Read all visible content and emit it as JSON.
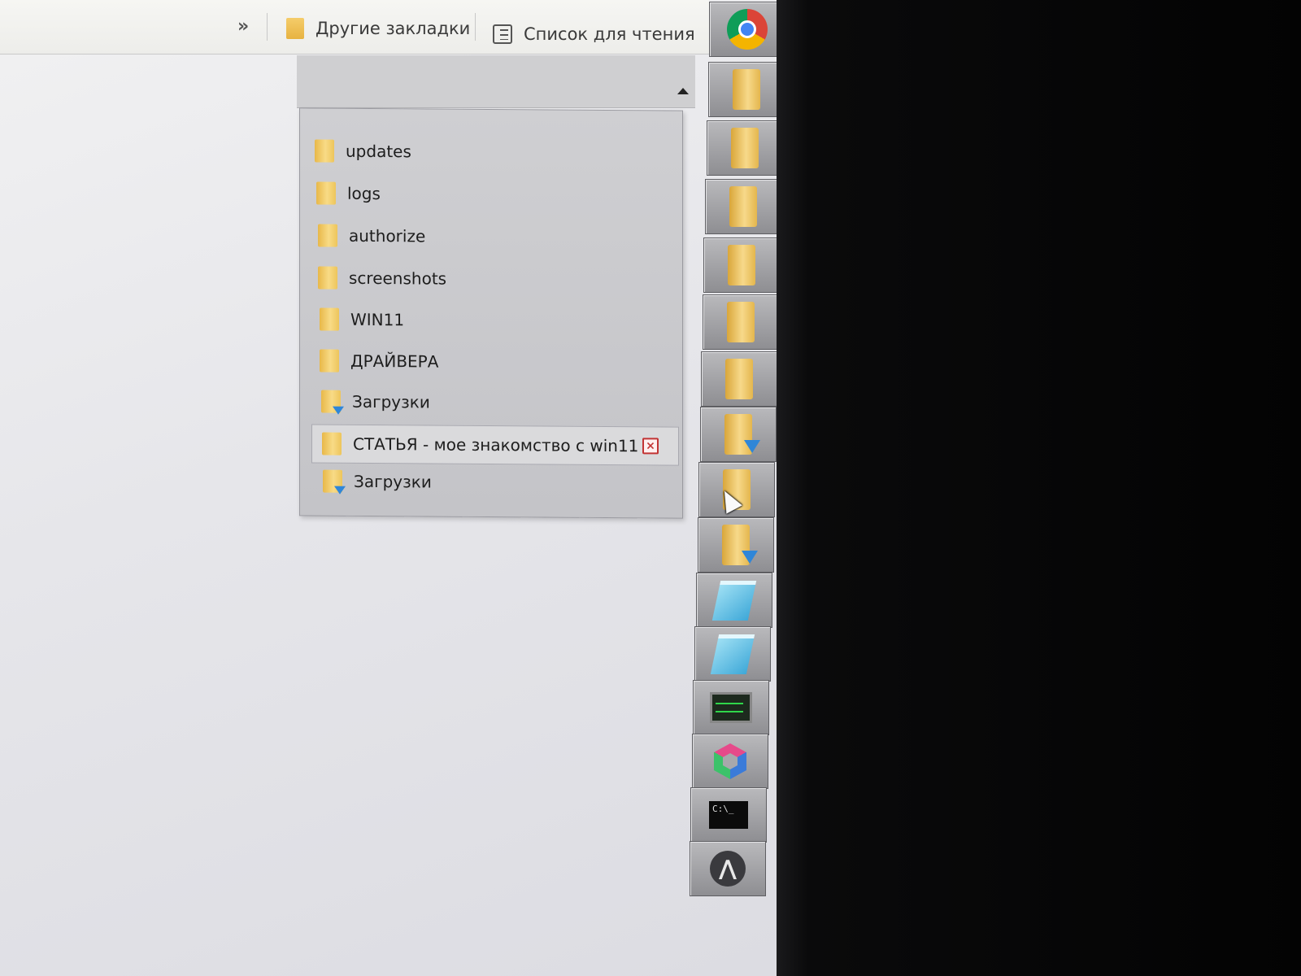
{
  "bookmarks_bar": {
    "overflow_chevron": "»",
    "other_bookmarks": "Другие закладки",
    "reading_list": "Список для чтения"
  },
  "folder_menu": {
    "items": [
      {
        "label": "updates",
        "icon": "folder-icon"
      },
      {
        "label": "logs",
        "icon": "folder-icon"
      },
      {
        "label": "authorize",
        "icon": "folder-icon"
      },
      {
        "label": "screenshots",
        "icon": "folder-icon"
      },
      {
        "label": "WIN11",
        "icon": "folder-icon"
      },
      {
        "label": "ДРАЙВЕРА",
        "icon": "folder-icon"
      },
      {
        "label": "Загрузки",
        "icon": "downloads-folder-icon"
      },
      {
        "label": "СТАТЬЯ - мое знакомство с win11",
        "icon": "folder-icon",
        "hovered": true
      },
      {
        "label": "Загрузки",
        "icon": "downloads-folder-icon"
      }
    ],
    "remove_symbol": "×"
  },
  "launcher": {
    "tiles": [
      "chrome-icon",
      "folder-icon",
      "folder-icon",
      "folder-icon",
      "folder-icon",
      "folder-icon",
      "folder-icon",
      "downloads-folder-icon",
      "folder-icon",
      "downloads-folder-icon",
      "notepad-icon",
      "notepad-icon",
      "system-monitor-icon",
      "hexagon-app-icon",
      "command-prompt-icon",
      "arch-logo-icon"
    ],
    "cmd_text": "C:\\_"
  }
}
